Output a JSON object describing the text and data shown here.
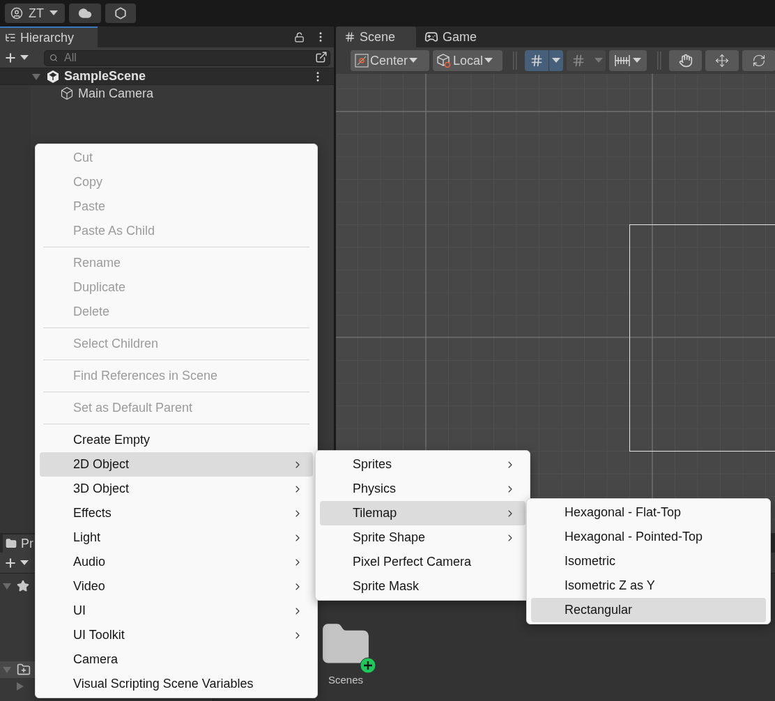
{
  "top_bar": {
    "account": "ZT"
  },
  "hierarchy": {
    "tab": "Hierarchy",
    "search": {
      "placeholder": "All"
    },
    "scene": {
      "name": "SampleScene",
      "expanded": true,
      "children": [
        {
          "name": "Main Camera"
        }
      ]
    }
  },
  "scene_view": {
    "tabs": [
      {
        "label": "Scene",
        "selected": true,
        "kind": "scene"
      },
      {
        "label": "Game",
        "selected": false,
        "kind": "game"
      }
    ],
    "toolbar": {
      "pivot": "Center",
      "space": "Local",
      "grid_snap": {
        "on": true
      },
      "increment_snap": {
        "on": false
      }
    }
  },
  "project": {
    "tab": "Pr",
    "folder": "Scenes"
  },
  "context_menu": {
    "items": [
      {
        "kind": "item",
        "label": "Cut",
        "disabled": true,
        "submenu": false,
        "highlighted": false
      },
      {
        "kind": "item",
        "label": "Copy",
        "disabled": true,
        "submenu": false,
        "highlighted": false
      },
      {
        "kind": "item",
        "label": "Paste",
        "disabled": true,
        "submenu": false,
        "highlighted": false
      },
      {
        "kind": "item",
        "label": "Paste As Child",
        "disabled": true,
        "submenu": false,
        "highlighted": false
      },
      {
        "kind": "separator"
      },
      {
        "kind": "item",
        "label": "Rename",
        "disabled": true,
        "submenu": false,
        "highlighted": false
      },
      {
        "kind": "item",
        "label": "Duplicate",
        "disabled": true,
        "submenu": false,
        "highlighted": false
      },
      {
        "kind": "item",
        "label": "Delete",
        "disabled": true,
        "submenu": false,
        "highlighted": false
      },
      {
        "kind": "separator"
      },
      {
        "kind": "item",
        "label": "Select Children",
        "disabled": true,
        "submenu": false,
        "highlighted": false
      },
      {
        "kind": "separator"
      },
      {
        "kind": "item",
        "label": "Find References in Scene",
        "disabled": true,
        "submenu": false,
        "highlighted": false
      },
      {
        "kind": "separator"
      },
      {
        "kind": "item",
        "label": "Set as Default Parent",
        "disabled": true,
        "submenu": false,
        "highlighted": false
      },
      {
        "kind": "separator"
      },
      {
        "kind": "item",
        "label": "Create Empty",
        "disabled": false,
        "submenu": false,
        "highlighted": false
      },
      {
        "kind": "item",
        "label": "2D Object",
        "disabled": false,
        "submenu": true,
        "highlighted": true
      },
      {
        "kind": "item",
        "label": "3D Object",
        "disabled": false,
        "submenu": true,
        "highlighted": false
      },
      {
        "kind": "item",
        "label": "Effects",
        "disabled": false,
        "submenu": true,
        "highlighted": false
      },
      {
        "kind": "item",
        "label": "Light",
        "disabled": false,
        "submenu": true,
        "highlighted": false
      },
      {
        "kind": "item",
        "label": "Audio",
        "disabled": false,
        "submenu": true,
        "highlighted": false
      },
      {
        "kind": "item",
        "label": "Video",
        "disabled": false,
        "submenu": true,
        "highlighted": false
      },
      {
        "kind": "item",
        "label": "UI",
        "disabled": false,
        "submenu": true,
        "highlighted": false
      },
      {
        "kind": "item",
        "label": "UI Toolkit",
        "disabled": false,
        "submenu": true,
        "highlighted": false
      },
      {
        "kind": "item",
        "label": "Camera",
        "disabled": false,
        "submenu": false,
        "highlighted": false
      },
      {
        "kind": "item",
        "label": "Visual Scripting Scene Variables",
        "disabled": false,
        "submenu": false,
        "highlighted": false
      }
    ]
  },
  "submenu_2d_object": {
    "items": [
      {
        "kind": "item",
        "label": "Sprites",
        "disabled": false,
        "submenu": true,
        "highlighted": false
      },
      {
        "kind": "item",
        "label": "Physics",
        "disabled": false,
        "submenu": true,
        "highlighted": false
      },
      {
        "kind": "item",
        "label": "Tilemap",
        "disabled": false,
        "submenu": true,
        "highlighted": true
      },
      {
        "kind": "item",
        "label": "Sprite Shape",
        "disabled": false,
        "submenu": true,
        "highlighted": false
      },
      {
        "kind": "item",
        "label": "Pixel Perfect Camera",
        "disabled": false,
        "submenu": false,
        "highlighted": false
      },
      {
        "kind": "item",
        "label": "Sprite Mask",
        "disabled": false,
        "submenu": false,
        "highlighted": false
      }
    ]
  },
  "submenu_tilemap": {
    "items": [
      {
        "kind": "item",
        "label": "Hexagonal - Flat-Top",
        "disabled": false,
        "submenu": false,
        "highlighted": false
      },
      {
        "kind": "item",
        "label": "Hexagonal - Pointed-Top",
        "disabled": false,
        "submenu": false,
        "highlighted": false
      },
      {
        "kind": "item",
        "label": "Isometric",
        "disabled": false,
        "submenu": false,
        "highlighted": false
      },
      {
        "kind": "item",
        "label": "Isometric Z as Y",
        "disabled": false,
        "submenu": false,
        "highlighted": false
      },
      {
        "kind": "item",
        "label": "Rectangular",
        "disabled": false,
        "submenu": false,
        "highlighted": true
      }
    ]
  }
}
